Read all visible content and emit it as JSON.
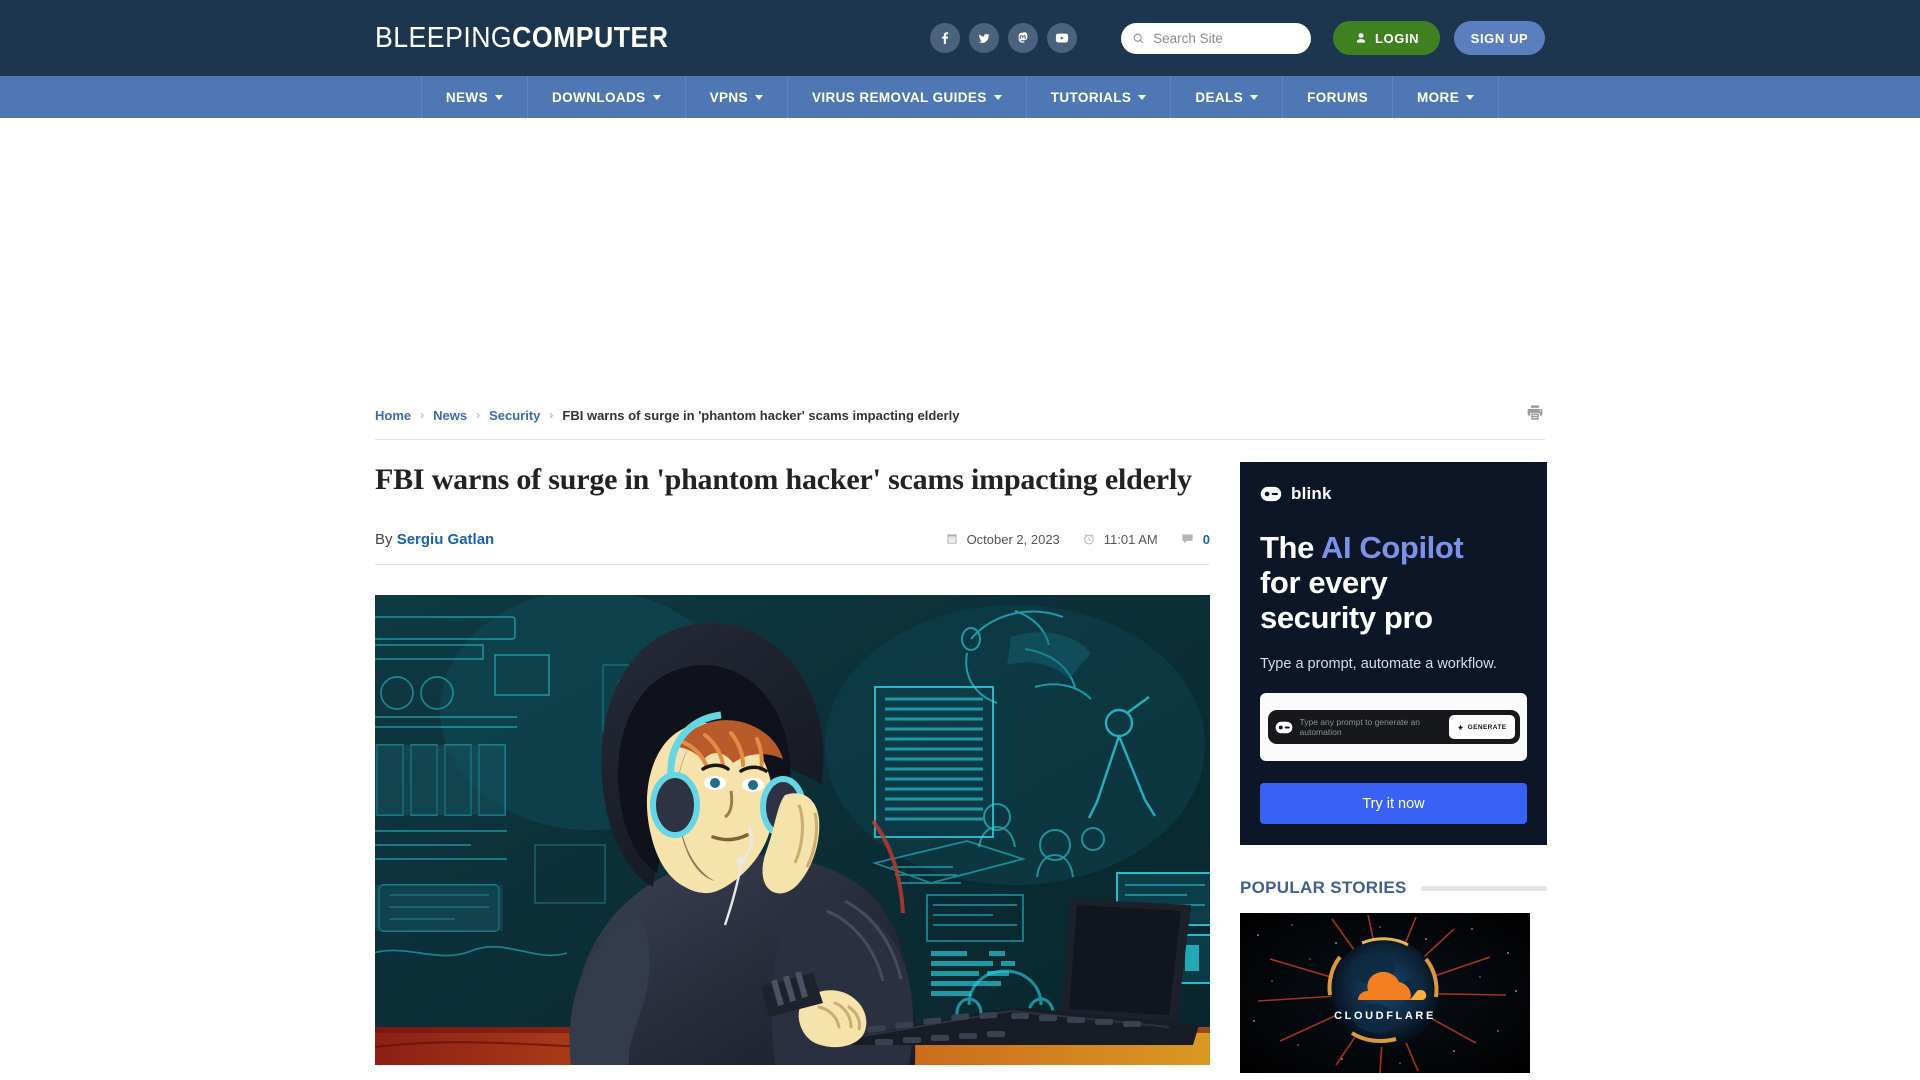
{
  "site": {
    "logo_light": "BLEEPING",
    "logo_bold": "COMPUTER",
    "colors": {
      "header_bg": "#1d3650",
      "nav_bg": "#4e77b4",
      "login_green": "#3f8121",
      "signup_blue": "#5b7fbe",
      "link_blue": "#3f6ba8",
      "ad_dark": "#0d1626",
      "ad_accent": "#7b92e8",
      "ad_button": "#3a61f5"
    }
  },
  "header": {
    "social": [
      {
        "name": "facebook-icon",
        "label": "Facebook"
      },
      {
        "name": "twitter-icon",
        "label": "Twitter"
      },
      {
        "name": "mastodon-icon",
        "label": "Mastodon"
      },
      {
        "name": "youtube-icon",
        "label": "YouTube"
      }
    ],
    "search": {
      "placeholder": "Search Site",
      "value": ""
    },
    "login_label": "LOGIN",
    "signup_label": "SIGN UP"
  },
  "nav": {
    "items": [
      {
        "label": "NEWS",
        "has_dropdown": true
      },
      {
        "label": "DOWNLOADS",
        "has_dropdown": true
      },
      {
        "label": "VPNS",
        "has_dropdown": true
      },
      {
        "label": "VIRUS REMOVAL GUIDES",
        "has_dropdown": true
      },
      {
        "label": "TUTORIALS",
        "has_dropdown": true
      },
      {
        "label": "DEALS",
        "has_dropdown": true
      },
      {
        "label": "FORUMS",
        "has_dropdown": false
      },
      {
        "label": "MORE",
        "has_dropdown": true
      }
    ]
  },
  "breadcrumb": {
    "items": [
      {
        "label": "Home",
        "link": true
      },
      {
        "label": "News",
        "link": true
      },
      {
        "label": "Security",
        "link": true
      },
      {
        "label": "FBI warns of surge in 'phantom hacker' scams impacting elderly",
        "link": false
      }
    ],
    "separator": "›",
    "print_icon": "printer-icon"
  },
  "article": {
    "headline": "FBI warns of surge in 'phantom hacker' scams impacting elderly",
    "by_prefix": "By",
    "author": "Sergiu Gatlan",
    "date": "October 2, 2023",
    "time": "11:01 AM",
    "comment_count": "0",
    "hero_alt": "Illustration of a hooded hacker wearing headphones working on a laptop"
  },
  "sidebar": {
    "ad": {
      "brand": "blink",
      "headline_1": "The ",
      "headline_accent": "AI Copilot",
      "headline_2": "for every",
      "headline_3": "security pro",
      "subtitle": "Type a prompt, automate a workflow.",
      "prompt_placeholder": "Type any prompt to generate an automation",
      "generate_label": "GENERATE",
      "cta_label": "Try it now"
    },
    "popular": {
      "title": "POPULAR STORIES",
      "thumb_label": "CLOUDFLARE"
    }
  }
}
